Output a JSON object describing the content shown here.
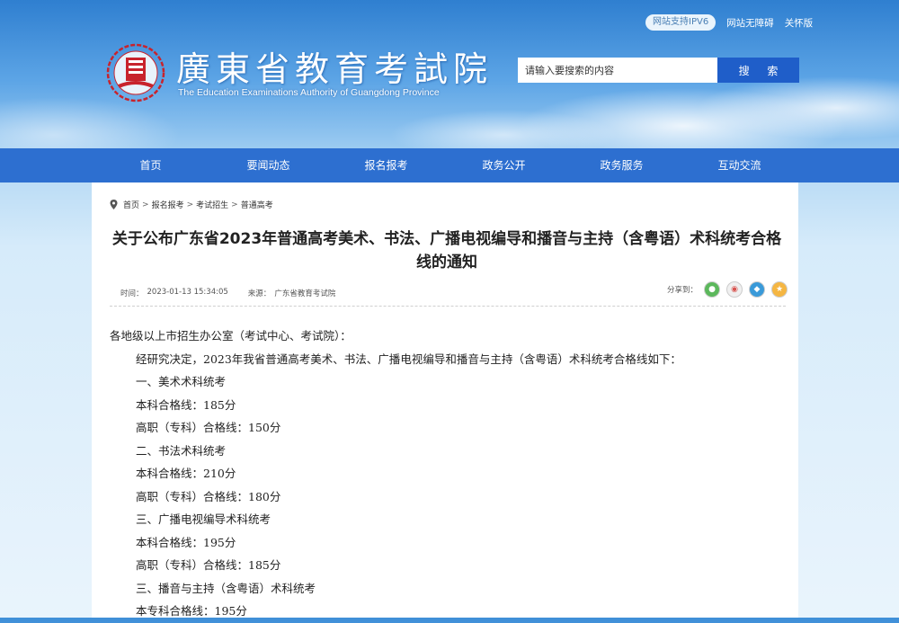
{
  "header": {
    "logo_title": "廣東省教育考試院",
    "logo_subtitle": "The Education Examinations Authority of Guangdong Province",
    "top_links": {
      "ipv6": "网站支持IPV6",
      "accessible": "网站无障碍",
      "care": "关怀版"
    },
    "search": {
      "placeholder": "请输入要搜索的内容",
      "button": "搜 索"
    }
  },
  "nav": {
    "items": [
      "首页",
      "要闻动态",
      "报名报考",
      "政务公开",
      "政务服务",
      "互动交流"
    ]
  },
  "breadcrumb": [
    "首页",
    "报名报考",
    "考试招生",
    "普通高考"
  ],
  "article": {
    "title": "关于公布广东省2023年普通高考美术、书法、广播电视编导和播音与主持（含粤语）术科统考合格线的通知",
    "time_label": "时间：",
    "time": "2023-01-13 15:34:05",
    "source_label": "来源：",
    "source": "广东省教育考试院",
    "share_label": "分享到：",
    "paragraphs": [
      "各地级以上市招生办公室（考试中心、考试院）：",
      "经研究决定，2023年我省普通高考美术、书法、广播电视编导和播音与主持（含粤语）术科统考合格线如下：",
      "一、美术术科统考",
      "本科合格线：185分",
      "高职（专科）合格线：150分",
      "二、书法术科统考",
      "本科合格线：210分",
      "高职（专科）合格线：180分",
      "三、广播电视编导术科统考",
      "本科合格线：195分",
      "高职（专科）合格线：185分",
      "三、播音与主持（含粤语）术科统考",
      "本专科合格线：195分"
    ]
  },
  "colors": {
    "nav": "#2d6fd0",
    "search_button": "#1f5ec9",
    "emblem": "#c8232c"
  }
}
